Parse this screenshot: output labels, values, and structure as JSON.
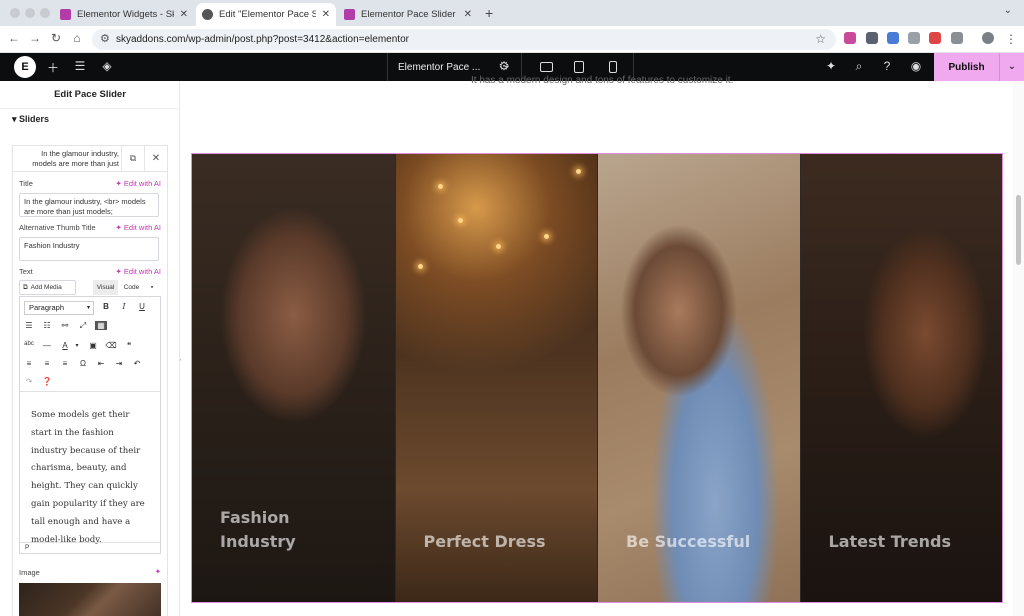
{
  "browser": {
    "tabs": [
      {
        "title": "Elementor Widgets - Sky Add",
        "active": false
      },
      {
        "title": "Edit \"Elementor Pace Slider W",
        "active": true
      },
      {
        "title": "Elementor Pace Slider Widge",
        "active": false
      }
    ],
    "new_tab": "+",
    "url": "skyaddons.com/wp-admin/post.php?post=3412&action=elementor"
  },
  "editor_bar": {
    "doc_name": "Elementor Pace ...",
    "publish_label": "Publish",
    "logo": "E"
  },
  "panel": {
    "title": "Edit Pace Slider",
    "section_label": "Sliders",
    "item_preview": "In the glamour industry, models are more than just mode",
    "fields": {
      "title_label": "Title",
      "title_value": "In the glamour industry, <br> models are more than just models;",
      "alt_label": "Alternative Thumb Title",
      "alt_value": "Fashion Industry",
      "text_label": "Text",
      "image_label": "Image",
      "edit_ai": "Edit with AI"
    },
    "text_editor": {
      "add_media": "Add Media",
      "visual_tab": "Visual",
      "code_tab": "Code",
      "format": "Paragraph",
      "content": "Some models get their start in the fashion industry because of their charisma, beauty, and height. They can quickly gain popularity if they are tall enough and have a model-like body.",
      "path": "P"
    }
  },
  "preview": {
    "intro_text": "It has a modern design and tons of features to customize it.",
    "slides": [
      {
        "title": "Fashion\nIndustry"
      },
      {
        "title": "Perfect Dress"
      },
      {
        "title": "Be Successful"
      },
      {
        "title": "Latest Trends"
      }
    ]
  },
  "colors": {
    "accent": "#f0a9ef",
    "ai_purple": "#c039b3",
    "topbar": "#0c0d0e"
  }
}
